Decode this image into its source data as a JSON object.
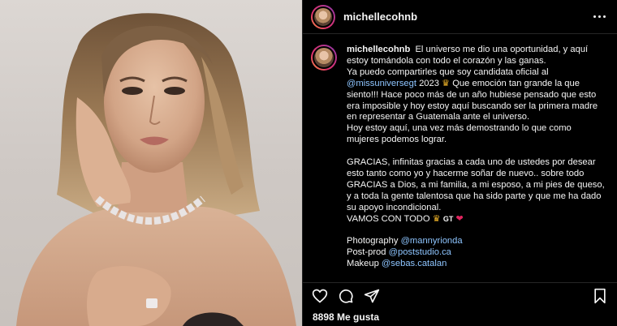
{
  "post": {
    "username": "michellecohnb",
    "likes_text": "8898 Me gusta"
  },
  "caption": {
    "username": "michellecohnb",
    "line1": "El universo me dio una oportunidad, y aquí estoy tomándola con todo el corazón y las ganas.",
    "line2a": "Ya puedo compartirles que soy candidata oficial al",
    "mention1": "@missuniversegt",
    "line2b": "2023",
    "line2c": "Que emoción tan grande la que siento!!! Hace poco más de un año hubiese pensado que esto era imposible y hoy estoy aquí buscando ser la primera madre en representar a Guatemala ante el universo.",
    "line3": "Hoy estoy aquí, una vez más demostrando lo que como mujeres podemos lograr.",
    "line4": "GRACIAS, infinitas gracias a cada uno de ustedes por desear esto tanto como yo y hacerme soñar de nuevo.. sobre todo GRACIAS a Dios, a mi familia, a mi esposo, a mi pies de queso, y a toda la gente talentosa que ha sido parte y que me ha dado su apoyo incondicional.",
    "line5": "VAMOS CON TODO",
    "gt": "GT",
    "photography_label": "Photography",
    "photography_mention": "@mannyrionda",
    "postprod_label": "Post-prod",
    "postprod_mention": "@poststudio.ca",
    "makeup_label": "Makeup",
    "makeup_mention": "@sebas.catalan"
  },
  "icons": {
    "more": "more-horizontal-icon",
    "like": "heart-outline-icon",
    "comment": "comment-bubble-icon",
    "share": "paper-plane-icon",
    "save": "bookmark-icon"
  },
  "colors": {
    "background": "#000000",
    "text": "#f5f5f5",
    "mention": "#8ec5ff",
    "divider": "#262626"
  }
}
